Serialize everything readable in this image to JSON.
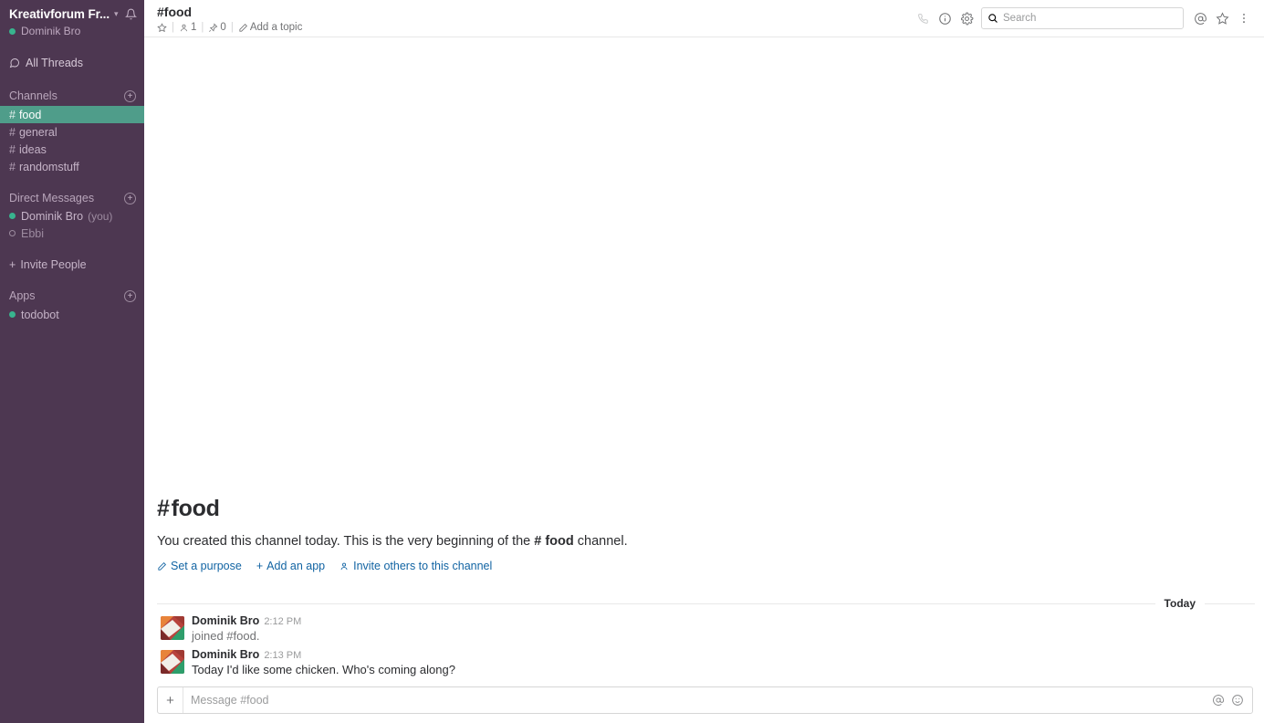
{
  "sidebar": {
    "workspace_title": "Kreativforum Fr...",
    "chevron_icon": "chevron-down-icon",
    "bell_icon": "bell-icon",
    "current_user": "Dominik Bro",
    "threads": {
      "label": "All Threads",
      "icon": "threads-icon"
    },
    "channels_section": {
      "label": "Channels",
      "add_icon": "plus-circle-icon"
    },
    "channels": [
      {
        "name": "food",
        "prefix": "#",
        "active": true
      },
      {
        "name": "general",
        "prefix": "#",
        "active": false
      },
      {
        "name": "ideas",
        "prefix": "#",
        "active": false
      },
      {
        "name": "randomstuff",
        "prefix": "#",
        "active": false
      }
    ],
    "dm_section": {
      "label": "Direct Messages",
      "add_icon": "plus-circle-icon"
    },
    "dms": [
      {
        "name": "Dominik Bro",
        "suffix": "(you)",
        "online": true
      },
      {
        "name": "Ebbi",
        "suffix": "",
        "online": false
      }
    ],
    "invite": {
      "label": "Invite People",
      "icon": "plus-icon"
    },
    "apps_section": {
      "label": "Apps",
      "add_icon": "plus-circle-icon"
    },
    "apps": [
      {
        "name": "todobot",
        "online": true
      }
    ]
  },
  "topbar": {
    "channel_name": "#food",
    "star_icon": "star-icon",
    "members_icon": "person-icon",
    "members_count": "1",
    "pins_icon": "pin-icon",
    "pins_count": "0",
    "topic_icon": "pencil-icon",
    "topic_label": "Add a topic",
    "separator": "|",
    "call_icon": "phone-icon",
    "info_icon": "info-circle-icon",
    "settings_icon": "gear-icon",
    "search_icon": "search-icon",
    "search_placeholder": "Search",
    "search_value": "",
    "mentions_icon": "at-icon",
    "starred_icon": "star-icon",
    "more_icon": "kebab-menu-icon"
  },
  "intro": {
    "hash": "#",
    "title": "food",
    "text_before": "You created this channel today. This is the very beginning of the",
    "text_channel": "# food",
    "text_after": "channel.",
    "links": [
      {
        "label": "Set a purpose",
        "icon": "pencil-icon"
      },
      {
        "label": "Add an app",
        "icon": "plus-icon"
      },
      {
        "label": "Invite others to this channel",
        "icon": "person-add-icon"
      }
    ]
  },
  "divider": {
    "label": "Today"
  },
  "messages": [
    {
      "author": "Dominik Bro",
      "time": "2:12 PM",
      "text": "joined #food.",
      "system": true,
      "avatar": "mosaic-avatar"
    },
    {
      "author": "Dominik Bro",
      "time": "2:13 PM",
      "text": "Today I'd like some chicken. Who's coming along?",
      "system": false,
      "avatar": "mosaic-avatar"
    }
  ],
  "composer": {
    "plus_icon": "plus-icon",
    "placeholder": "Message #food",
    "value": "",
    "mention_icon": "at-icon",
    "emoji_icon": "emoji-smiley-icon"
  },
  "colors": {
    "sidebar_bg": "#4d3751",
    "active_channel_bg": "#4f9d8a",
    "online_dot": "#38b48e",
    "link_blue": "#1264a3",
    "text_dark": "#2c2d30"
  }
}
